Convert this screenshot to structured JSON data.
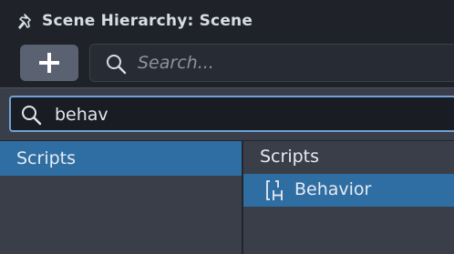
{
  "panel": {
    "title": "Scene Hierarchy: Scene"
  },
  "toolbar": {
    "search_placeholder": "Search..."
  },
  "popup": {
    "search_value": "behav",
    "categories": [
      {
        "label": "Scripts",
        "selected": true
      }
    ],
    "results_header": "Scripts",
    "results": [
      {
        "label": "Behavior",
        "icon": "behavior-script-icon",
        "selected": true
      }
    ]
  },
  "colors": {
    "selection": "#2f6ea3",
    "focus_border": "#6fa3d6",
    "panel_bg": "#1f2229",
    "popup_bg": "#3a3e48"
  }
}
